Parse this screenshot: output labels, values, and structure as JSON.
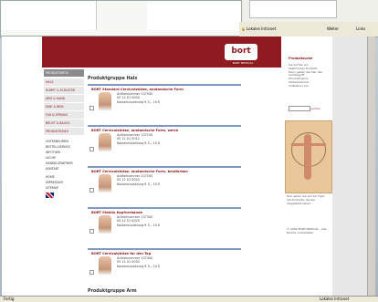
{
  "ie": {
    "address_label": "Lokales Intranet",
    "links": "Weiter",
    "links2": "Links"
  },
  "header": {
    "logo": "bort",
    "sub": "BORT MEDICAL"
  },
  "nav": {
    "top": "PRODUKTINFOS",
    "items": [
      "HALS",
      "RUMPF & SCHULTER",
      "ARM & HAND",
      "KNIE & BEIN",
      "FUß & SPRUNG",
      "BRUST & BAUCH",
      "PRODUKTE/NEU"
    ],
    "links": [
      "UNTERNEHMEN",
      "BESTELLSERVICE",
      "INFOTHEK",
      "SUCHE",
      "HANDELSPARTNER",
      "KONTAKT"
    ],
    "bottom": [
      "HOME",
      "IMPRESSUM",
      "SITEMAP"
    ]
  },
  "content": {
    "title": "Produktgruppe Hals",
    "products": [
      {
        "name": "BORT Standard Cervicalstütze, anatomische Form",
        "art": "Artikelnummer 137000",
        "code": "05 12 01 0000",
        "note": "Kassenzuzahlung € 5,– 10 €"
      },
      {
        "name": "BORT Cervicalstütze, anatomische Form, weich",
        "art": "Artikelnummer 137100",
        "code": "05 12 01 0012",
        "note": "Kassenzuzahlung € 5,– 10 €"
      },
      {
        "name": "BORT Cervicalstütze, anatomische Form, bestfarben",
        "art": "Artikelnummer 137200",
        "code": "05 12 01 0020",
        "note": "Kassenzuzahlung € 5,– 10 €"
      },
      {
        "name": "BORT Stabilo Kopfverbände",
        "art": "Artikelnummer 137300",
        "code": "05 12 01 0025",
        "note": "Kassenzuzahlung € 5,– 10 €"
      },
      {
        "name": "BORT Cervicalstütze für den Tag",
        "art": "Artikelnummer 137400",
        "code": "05 12 01 0030",
        "note": "Kassenzuzahlung € 5,– 10 €"
      }
    ],
    "next": "Produktgruppe Arm"
  },
  "right": {
    "title": "Produktsuche",
    "text": "Sie suchen ein bestimmtes Produkt? Dann geben Sie hier den Suchbegriff (Produktname, Artikelnummer, Indikation) ein.",
    "btn": "suchen",
    "caption": "Hier sehen Sie auf der Figur die Produkte, die Sie dargestellt sehen.",
    "copy": "© 2004 BORT MEDICAL · Alle Rechte vorbehalten"
  },
  "status": {
    "left": "Fertig",
    "right": "Lokales Intranet"
  }
}
